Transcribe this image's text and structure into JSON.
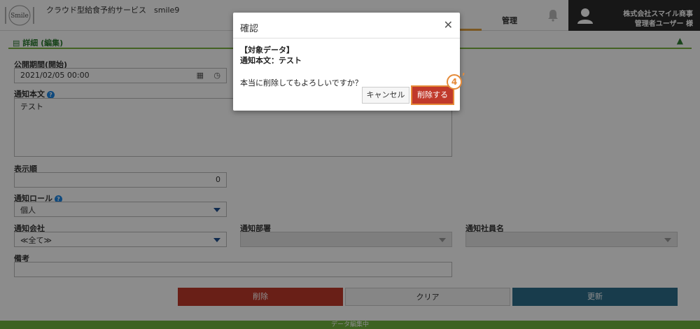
{
  "header": {
    "service_title": "クラウド型給食予約サービス　smile9",
    "logo_text": "Smile",
    "nav_kanri": "管理",
    "company": "株式会社スマイル商事",
    "user": "管理者ユーザー 様"
  },
  "section": {
    "title": "詳細 (編集)"
  },
  "form": {
    "period_label": "公開期間(開始)",
    "period_value": "2021/02/05 00:00",
    "body_label": "通知本文",
    "body_value": "テスト",
    "order_label": "表示順",
    "order_value": "0",
    "role_label": "通知ロール",
    "role_value": "個人",
    "company_label": "通知会社",
    "company_value": "≪全て≫",
    "dept_label": "通知部署",
    "employee_label": "通知社員名",
    "note_label": "備考"
  },
  "buttons": {
    "delete": "削除",
    "clear": "クリア",
    "update": "更新"
  },
  "footer": {
    "status": "データ編集中"
  },
  "modal": {
    "title": "確認",
    "target_label": "【対象データ】",
    "target_value": "通知本文：テスト",
    "question": "本当に削除してもよろしいですか？",
    "cancel": "キャンセル",
    "confirm": "削除する",
    "step": "4"
  },
  "colors": {
    "accent_green": "#6fb33f",
    "delete_red": "#c0392b",
    "update_blue": "#2c6e8a",
    "highlight_orange": "#e58a38"
  }
}
